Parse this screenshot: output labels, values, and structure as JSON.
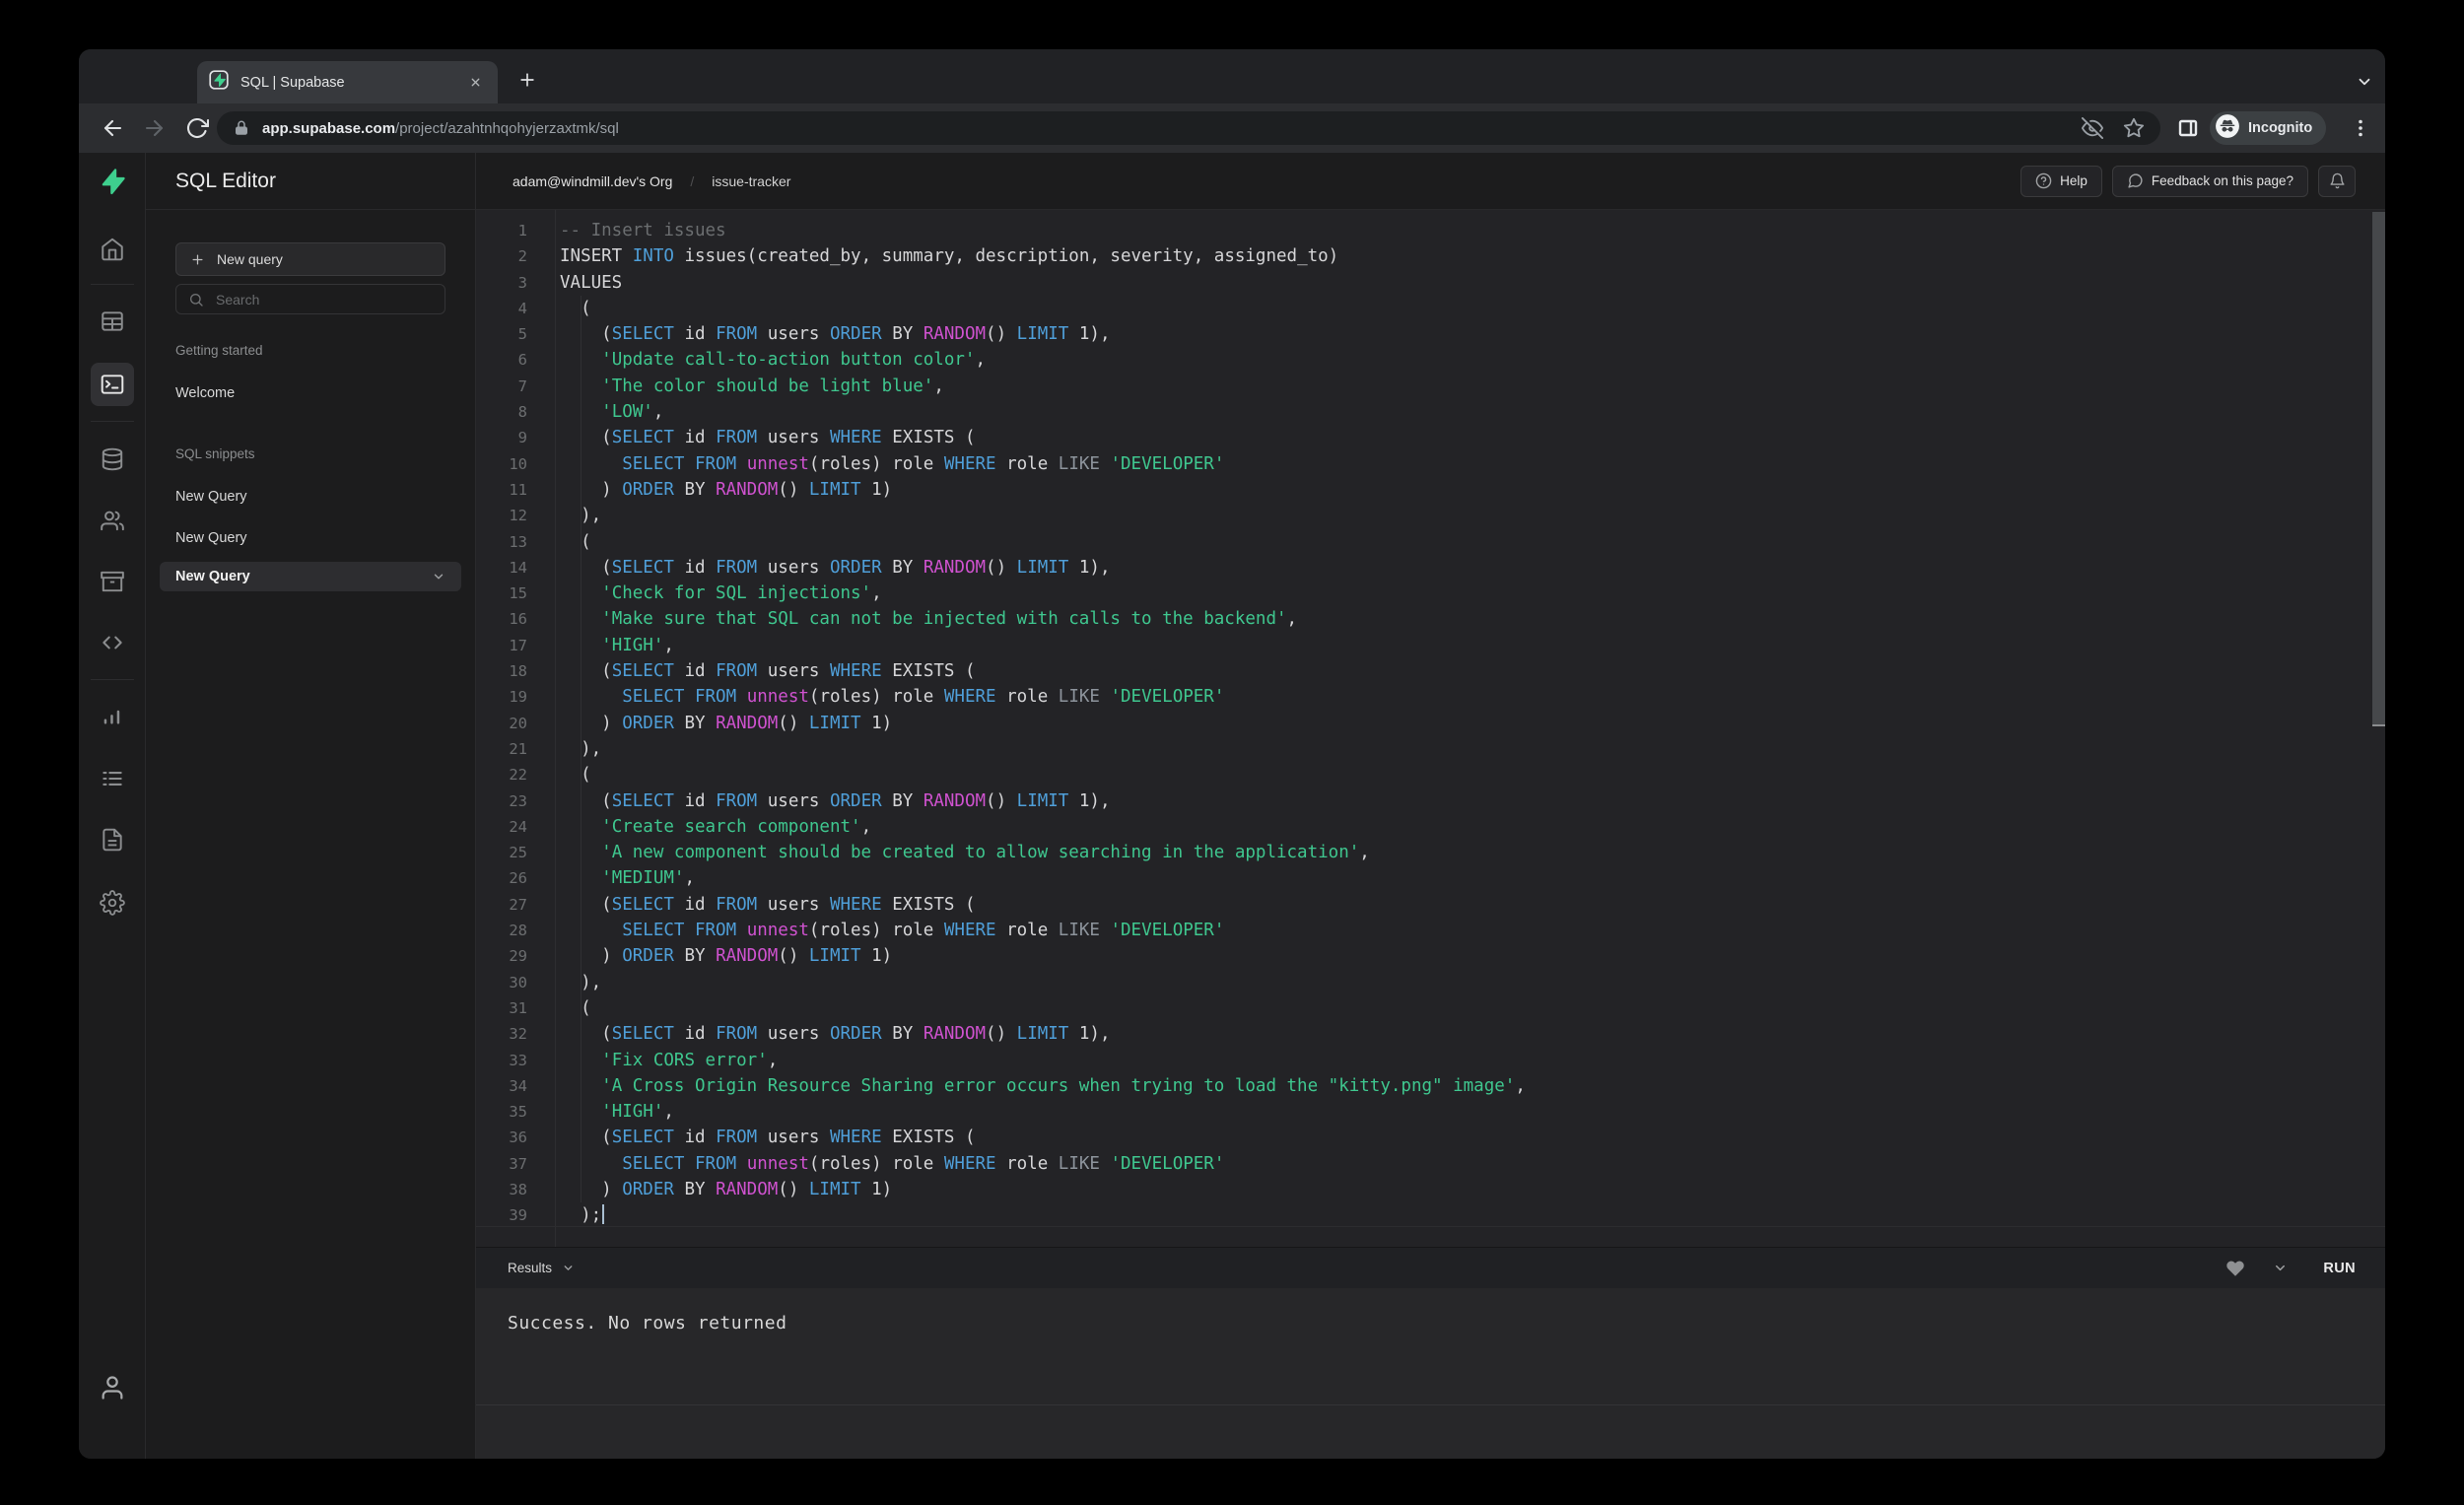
{
  "colors": {
    "traffic_red": "#ff5f57",
    "traffic_yellow": "#febc2e",
    "traffic_green": "#28c840",
    "brand_green": "#3ecf8e",
    "keyword_blue": "#4f9fd9",
    "function_magenta": "#cf52cf",
    "string_green": "#3fc78f",
    "comment_gray": "#6b6e70",
    "operator_gray": "#8d949c"
  },
  "browser": {
    "tab_title": "SQL | Supabase",
    "url_host": "app.supabase.com",
    "url_path": "/project/azahtnhqohyjerzaxtmk/sql",
    "incognito_label": "Incognito"
  },
  "sidebar": {
    "icons": [
      {
        "name": "supabase-logo",
        "active": false
      },
      {
        "name": "home",
        "active": false
      },
      {
        "name": "divider"
      },
      {
        "name": "table-editor",
        "active": false
      },
      {
        "name": "sql-editor",
        "active": true
      },
      {
        "name": "divider"
      },
      {
        "name": "database",
        "active": false
      },
      {
        "name": "auth-users",
        "active": false
      },
      {
        "name": "storage",
        "active": false
      },
      {
        "name": "api-code",
        "active": false
      },
      {
        "name": "divider"
      },
      {
        "name": "reports",
        "active": false
      },
      {
        "name": "logs",
        "active": false
      },
      {
        "name": "docs",
        "active": false
      },
      {
        "name": "settings",
        "active": false
      }
    ],
    "account_icon": "account"
  },
  "query_panel": {
    "title": "SQL Editor",
    "new_query_button": "New query",
    "search_placeholder": "Search",
    "sections": [
      {
        "label": "Getting started",
        "items": [
          {
            "label": "Welcome",
            "active": false
          }
        ]
      },
      {
        "label": "SQL snippets",
        "items": [
          {
            "label": "New Query",
            "active": false
          },
          {
            "label": "New Query",
            "active": false
          },
          {
            "label": "New Query",
            "active": true
          }
        ]
      }
    ]
  },
  "header": {
    "breadcrumb_org": "adam@windmill.dev's Org",
    "breadcrumb_separator": "/",
    "breadcrumb_project": "issue-tracker",
    "help_label": "Help",
    "feedback_label": "Feedback on this page?"
  },
  "editor": {
    "lines": [
      {
        "n": 1,
        "segs": [
          [
            "c",
            "-- Insert issues"
          ]
        ]
      },
      {
        "n": 2,
        "segs": [
          [
            "w",
            "INSERT "
          ],
          [
            "k",
            "INTO"
          ],
          [
            "w",
            " issues(created_by, summary, description, severity, assigned_to)"
          ]
        ]
      },
      {
        "n": 3,
        "segs": [
          [
            "w",
            "VALUES"
          ]
        ]
      },
      {
        "n": 4,
        "segs": [
          [
            "w",
            "  ("
          ]
        ]
      },
      {
        "n": 5,
        "segs": [
          [
            "w",
            "    ("
          ],
          [
            "k",
            "SELECT"
          ],
          [
            "w",
            " id "
          ],
          [
            "k",
            "FROM"
          ],
          [
            "w",
            " users "
          ],
          [
            "k",
            "ORDER"
          ],
          [
            "w",
            " BY "
          ],
          [
            "f",
            "RANDOM"
          ],
          [
            "w",
            "() "
          ],
          [
            "k",
            "LIMIT"
          ],
          [
            "w",
            " 1),"
          ]
        ]
      },
      {
        "n": 6,
        "segs": [
          [
            "w",
            "    "
          ],
          [
            "s",
            "'Update call-to-action button color'"
          ],
          [
            "w",
            ","
          ]
        ]
      },
      {
        "n": 7,
        "segs": [
          [
            "w",
            "    "
          ],
          [
            "s",
            "'The color should be light blue'"
          ],
          [
            "w",
            ","
          ]
        ]
      },
      {
        "n": 8,
        "segs": [
          [
            "w",
            "    "
          ],
          [
            "s",
            "'LOW'"
          ],
          [
            "w",
            ","
          ]
        ]
      },
      {
        "n": 9,
        "segs": [
          [
            "w",
            "    ("
          ],
          [
            "k",
            "SELECT"
          ],
          [
            "w",
            " id "
          ],
          [
            "k",
            "FROM"
          ],
          [
            "w",
            " users "
          ],
          [
            "k",
            "WHERE"
          ],
          [
            "w",
            " EXISTS ("
          ]
        ]
      },
      {
        "n": 10,
        "segs": [
          [
            "w",
            "      "
          ],
          [
            "k",
            "SELECT"
          ],
          [
            "w",
            " "
          ],
          [
            "k",
            "FROM"
          ],
          [
            "w",
            " "
          ],
          [
            "f",
            "unnest"
          ],
          [
            "w",
            "(roles) role "
          ],
          [
            "k",
            "WHERE"
          ],
          [
            "w",
            " role "
          ],
          [
            "g",
            "LIKE"
          ],
          [
            "w",
            " "
          ],
          [
            "s",
            "'DEVELOPER'"
          ]
        ]
      },
      {
        "n": 11,
        "segs": [
          [
            "w",
            "    ) "
          ],
          [
            "k",
            "ORDER"
          ],
          [
            "w",
            " BY "
          ],
          [
            "f",
            "RANDOM"
          ],
          [
            "w",
            "() "
          ],
          [
            "k",
            "LIMIT"
          ],
          [
            "w",
            " 1)"
          ]
        ]
      },
      {
        "n": 12,
        "segs": [
          [
            "w",
            "  ),"
          ]
        ]
      },
      {
        "n": 13,
        "segs": [
          [
            "w",
            "  ("
          ]
        ]
      },
      {
        "n": 14,
        "segs": [
          [
            "w",
            "    ("
          ],
          [
            "k",
            "SELECT"
          ],
          [
            "w",
            " id "
          ],
          [
            "k",
            "FROM"
          ],
          [
            "w",
            " users "
          ],
          [
            "k",
            "ORDER"
          ],
          [
            "w",
            " BY "
          ],
          [
            "f",
            "RANDOM"
          ],
          [
            "w",
            "() "
          ],
          [
            "k",
            "LIMIT"
          ],
          [
            "w",
            " 1),"
          ]
        ]
      },
      {
        "n": 15,
        "segs": [
          [
            "w",
            "    "
          ],
          [
            "s",
            "'Check for SQL injections'"
          ],
          [
            "w",
            ","
          ]
        ]
      },
      {
        "n": 16,
        "segs": [
          [
            "w",
            "    "
          ],
          [
            "s",
            "'Make sure that SQL can not be injected with calls to the backend'"
          ],
          [
            "w",
            ","
          ]
        ]
      },
      {
        "n": 17,
        "segs": [
          [
            "w",
            "    "
          ],
          [
            "s",
            "'HIGH'"
          ],
          [
            "w",
            ","
          ]
        ]
      },
      {
        "n": 18,
        "segs": [
          [
            "w",
            "    ("
          ],
          [
            "k",
            "SELECT"
          ],
          [
            "w",
            " id "
          ],
          [
            "k",
            "FROM"
          ],
          [
            "w",
            " users "
          ],
          [
            "k",
            "WHERE"
          ],
          [
            "w",
            " EXISTS ("
          ]
        ]
      },
      {
        "n": 19,
        "segs": [
          [
            "w",
            "      "
          ],
          [
            "k",
            "SELECT"
          ],
          [
            "w",
            " "
          ],
          [
            "k",
            "FROM"
          ],
          [
            "w",
            " "
          ],
          [
            "f",
            "unnest"
          ],
          [
            "w",
            "(roles) role "
          ],
          [
            "k",
            "WHERE"
          ],
          [
            "w",
            " role "
          ],
          [
            "g",
            "LIKE"
          ],
          [
            "w",
            " "
          ],
          [
            "s",
            "'DEVELOPER'"
          ]
        ]
      },
      {
        "n": 20,
        "segs": [
          [
            "w",
            "    ) "
          ],
          [
            "k",
            "ORDER"
          ],
          [
            "w",
            " BY "
          ],
          [
            "f",
            "RANDOM"
          ],
          [
            "w",
            "() "
          ],
          [
            "k",
            "LIMIT"
          ],
          [
            "w",
            " 1)"
          ]
        ]
      },
      {
        "n": 21,
        "segs": [
          [
            "w",
            "  ),"
          ]
        ]
      },
      {
        "n": 22,
        "segs": [
          [
            "w",
            "  ("
          ]
        ]
      },
      {
        "n": 23,
        "segs": [
          [
            "w",
            "    ("
          ],
          [
            "k",
            "SELECT"
          ],
          [
            "w",
            " id "
          ],
          [
            "k",
            "FROM"
          ],
          [
            "w",
            " users "
          ],
          [
            "k",
            "ORDER"
          ],
          [
            "w",
            " BY "
          ],
          [
            "f",
            "RANDOM"
          ],
          [
            "w",
            "() "
          ],
          [
            "k",
            "LIMIT"
          ],
          [
            "w",
            " 1),"
          ]
        ]
      },
      {
        "n": 24,
        "segs": [
          [
            "w",
            "    "
          ],
          [
            "s",
            "'Create search component'"
          ],
          [
            "w",
            ","
          ]
        ]
      },
      {
        "n": 25,
        "segs": [
          [
            "w",
            "    "
          ],
          [
            "s",
            "'A new component should be created to allow searching in the application'"
          ],
          [
            "w",
            ","
          ]
        ]
      },
      {
        "n": 26,
        "segs": [
          [
            "w",
            "    "
          ],
          [
            "s",
            "'MEDIUM'"
          ],
          [
            "w",
            ","
          ]
        ]
      },
      {
        "n": 27,
        "segs": [
          [
            "w",
            "    ("
          ],
          [
            "k",
            "SELECT"
          ],
          [
            "w",
            " id "
          ],
          [
            "k",
            "FROM"
          ],
          [
            "w",
            " users "
          ],
          [
            "k",
            "WHERE"
          ],
          [
            "w",
            " EXISTS ("
          ]
        ]
      },
      {
        "n": 28,
        "segs": [
          [
            "w",
            "      "
          ],
          [
            "k",
            "SELECT"
          ],
          [
            "w",
            " "
          ],
          [
            "k",
            "FROM"
          ],
          [
            "w",
            " "
          ],
          [
            "f",
            "unnest"
          ],
          [
            "w",
            "(roles) role "
          ],
          [
            "k",
            "WHERE"
          ],
          [
            "w",
            " role "
          ],
          [
            "g",
            "LIKE"
          ],
          [
            "w",
            " "
          ],
          [
            "s",
            "'DEVELOPER'"
          ]
        ]
      },
      {
        "n": 29,
        "segs": [
          [
            "w",
            "    ) "
          ],
          [
            "k",
            "ORDER"
          ],
          [
            "w",
            " BY "
          ],
          [
            "f",
            "RANDOM"
          ],
          [
            "w",
            "() "
          ],
          [
            "k",
            "LIMIT"
          ],
          [
            "w",
            " 1)"
          ]
        ]
      },
      {
        "n": 30,
        "segs": [
          [
            "w",
            "  ),"
          ]
        ]
      },
      {
        "n": 31,
        "segs": [
          [
            "w",
            "  ("
          ]
        ]
      },
      {
        "n": 32,
        "segs": [
          [
            "w",
            "    ("
          ],
          [
            "k",
            "SELECT"
          ],
          [
            "w",
            " id "
          ],
          [
            "k",
            "FROM"
          ],
          [
            "w",
            " users "
          ],
          [
            "k",
            "ORDER"
          ],
          [
            "w",
            " BY "
          ],
          [
            "f",
            "RANDOM"
          ],
          [
            "w",
            "() "
          ],
          [
            "k",
            "LIMIT"
          ],
          [
            "w",
            " 1),"
          ]
        ]
      },
      {
        "n": 33,
        "segs": [
          [
            "w",
            "    "
          ],
          [
            "s",
            "'Fix CORS error'"
          ],
          [
            "w",
            ","
          ]
        ]
      },
      {
        "n": 34,
        "segs": [
          [
            "w",
            "    "
          ],
          [
            "s",
            "'A Cross Origin Resource Sharing error occurs when trying to load the \"kitty.png\" image'"
          ],
          [
            "w",
            ","
          ]
        ]
      },
      {
        "n": 35,
        "segs": [
          [
            "w",
            "    "
          ],
          [
            "s",
            "'HIGH'"
          ],
          [
            "w",
            ","
          ]
        ]
      },
      {
        "n": 36,
        "segs": [
          [
            "w",
            "    ("
          ],
          [
            "k",
            "SELECT"
          ],
          [
            "w",
            " id "
          ],
          [
            "k",
            "FROM"
          ],
          [
            "w",
            " users "
          ],
          [
            "k",
            "WHERE"
          ],
          [
            "w",
            " EXISTS ("
          ]
        ]
      },
      {
        "n": 37,
        "segs": [
          [
            "w",
            "      "
          ],
          [
            "k",
            "SELECT"
          ],
          [
            "w",
            " "
          ],
          [
            "k",
            "FROM"
          ],
          [
            "w",
            " "
          ],
          [
            "f",
            "unnest"
          ],
          [
            "w",
            "(roles) role "
          ],
          [
            "k",
            "WHERE"
          ],
          [
            "w",
            " role "
          ],
          [
            "g",
            "LIKE"
          ],
          [
            "w",
            " "
          ],
          [
            "s",
            "'DEVELOPER'"
          ]
        ]
      },
      {
        "n": 38,
        "segs": [
          [
            "w",
            "    ) "
          ],
          [
            "k",
            "ORDER"
          ],
          [
            "w",
            " BY "
          ],
          [
            "f",
            "RANDOM"
          ],
          [
            "w",
            "() "
          ],
          [
            "k",
            "LIMIT"
          ],
          [
            "w",
            " 1)"
          ]
        ]
      },
      {
        "n": 39,
        "segs": [
          [
            "w",
            "  );"
          ]
        ],
        "caret": true
      }
    ]
  },
  "results": {
    "label": "Results",
    "run_label": "RUN",
    "message": "Success. No rows returned"
  }
}
